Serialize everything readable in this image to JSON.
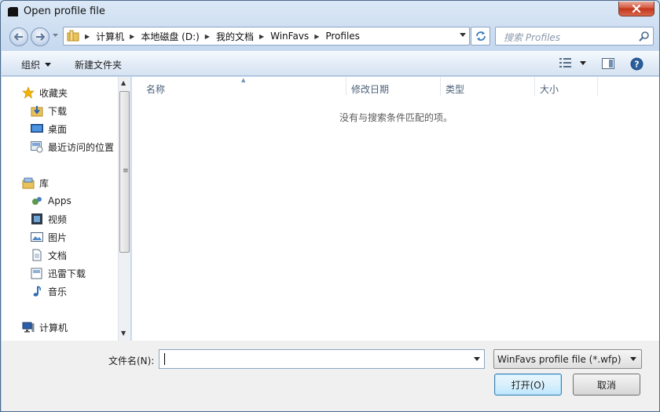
{
  "window": {
    "title": "Open profile file"
  },
  "address": {
    "crumbs": [
      "计算机",
      "本地磁盘 (D:)",
      "我的文档",
      "WinFavs",
      "Profiles"
    ]
  },
  "search": {
    "placeholder": "搜索 Profiles"
  },
  "toolbar": {
    "organize": "组织",
    "new_folder": "新建文件夹"
  },
  "nav": {
    "favorites": {
      "label": "收藏夹",
      "items": [
        "下载",
        "桌面",
        "最近访问的位置"
      ]
    },
    "libraries": {
      "label": "库",
      "items": [
        "Apps",
        "视频",
        "图片",
        "文档",
        "迅雷下载",
        "音乐"
      ]
    },
    "computer": {
      "label": "计算机"
    }
  },
  "filelist": {
    "columns": [
      "名称",
      "修改日期",
      "类型",
      "大小"
    ],
    "empty_message": "没有与搜索条件匹配的项。"
  },
  "bottom": {
    "filename_label": "文件名(N):",
    "filename_value": "",
    "filter_value": "WinFavs profile file (*.wfp)",
    "open_label": "打开(O)",
    "cancel_label": "取消"
  },
  "icons": {
    "star": "star-icon",
    "download": "download-folder-icon",
    "desktop": "desktop-icon",
    "recent": "recent-places-icon",
    "library": "library-icon",
    "computer": "computer-icon"
  },
  "colors": {
    "accent": "#3c7fb1",
    "close": "#c2351c",
    "star": "#f2b400"
  }
}
